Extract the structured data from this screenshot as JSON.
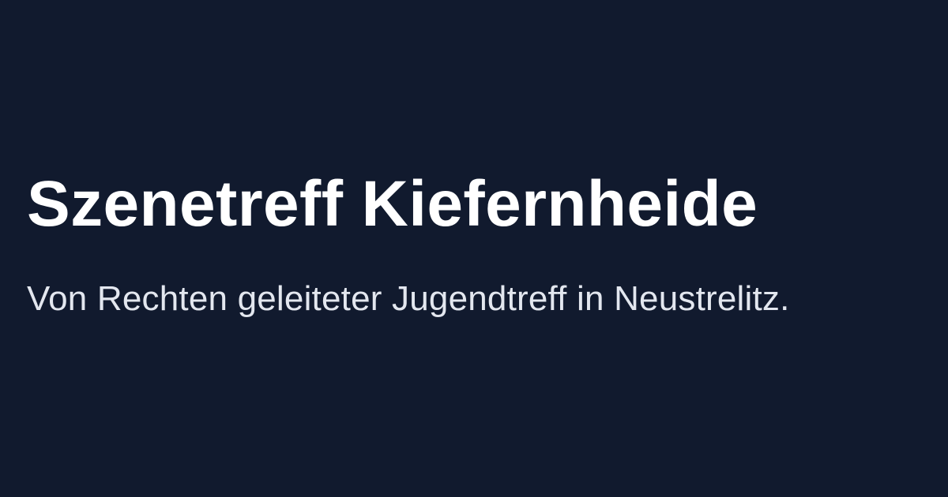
{
  "card": {
    "title": "Szenetreff Kiefernheide",
    "subtitle": "Von Rechten geleiteter Jugendtreff in Neustrelitz."
  },
  "colors": {
    "background": "#111a2e",
    "title": "#ffffff",
    "subtitle": "#e3e7ef"
  }
}
